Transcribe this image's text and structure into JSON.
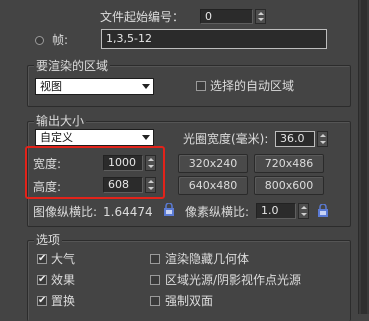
{
  "top": {
    "file_start_label": "文件起始编号：",
    "file_start_value": "0",
    "frames_label": "帧:",
    "frames_value": "1,3,5-12"
  },
  "render_area": {
    "title": "要渲染的区域",
    "view_value": "视图",
    "auto_region_label": "选择的自动区域"
  },
  "output_size": {
    "title": "输出大小",
    "preset_value": "自定义",
    "aperture_label": "光圈宽度(毫米):",
    "aperture_value": "36.0",
    "width_label": "宽度:",
    "width_value": "1000",
    "height_label": "高度:",
    "height_value": "608",
    "presets": [
      "320x240",
      "720x486",
      "640x480",
      "800x600"
    ],
    "image_aspect_label": "图像纵横比:",
    "image_aspect_value": "1.64474",
    "pixel_aspect_label": "像素纵横比:",
    "pixel_aspect_value": "1.0"
  },
  "options": {
    "title": "选项",
    "items_left": [
      {
        "label": "大气",
        "checked": true
      },
      {
        "label": "效果",
        "checked": true
      },
      {
        "label": "置换",
        "checked": true
      }
    ],
    "items_right": [
      {
        "label": "渲染隐藏几何体",
        "checked": false
      },
      {
        "label": "区域光源/阴影视作点光源",
        "checked": false
      },
      {
        "label": "强制双面",
        "checked": false
      }
    ]
  },
  "colors": {
    "background": "#444444",
    "highlight": "#e2231a",
    "lock_icon": "#5b7bd5"
  }
}
